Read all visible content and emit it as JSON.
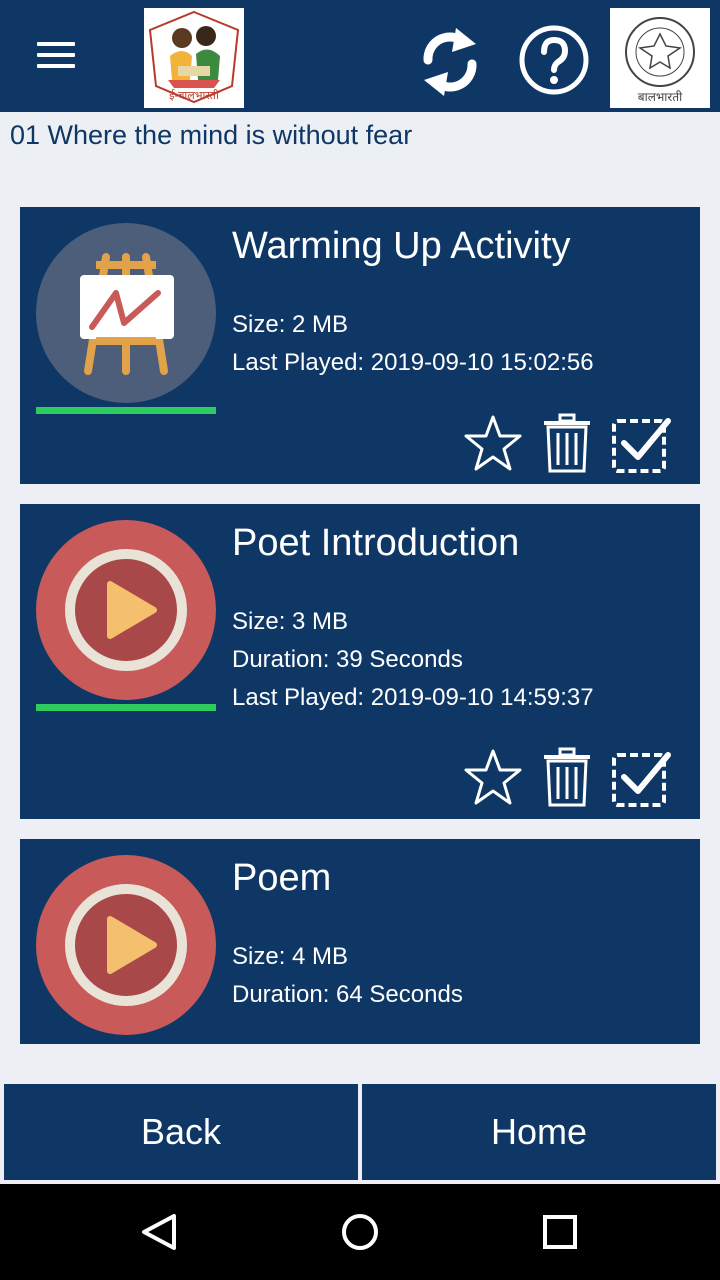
{
  "header": {
    "menu_icon": "hamburger-menu-icon",
    "left_logo": "e-balbharati-logo",
    "left_logo_text": "ई-बालभारती",
    "sync_icon": "sync-icon",
    "help_icon": "help-icon",
    "right_logo": "balbharati-emblem-logo",
    "right_logo_text": "बालभारती",
    "bar_color": "#0f3766"
  },
  "subtitle": "01 Where the mind is without fear",
  "items": [
    {
      "title": "Warming Up Activity",
      "thumbnail": "easel-activity-icon",
      "size": "Size: 2 MB",
      "last_played": "Last Played: 2019-09-10 15:02:56",
      "progress": 1.0,
      "actions": [
        "star-icon",
        "trash-icon",
        "checkbox-icon"
      ]
    },
    {
      "title": "Poet Introduction",
      "thumbnail": "play-video-icon",
      "size": "Size: 3 MB",
      "duration": "Duration: 39 Seconds",
      "last_played": "Last Played: 2019-09-10 14:59:37",
      "progress": 1.0,
      "actions": [
        "star-icon",
        "trash-icon",
        "checkbox-icon"
      ]
    },
    {
      "title": "Poem",
      "thumbnail": "play-video-icon",
      "size": "Size: 4 MB",
      "duration": "Duration: 64 Seconds"
    }
  ],
  "footer": {
    "back_label": "Back",
    "home_label": "Home"
  },
  "system_nav": {
    "back_icon": "nav-back-icon",
    "home_icon": "nav-home-icon",
    "recents_icon": "nav-recents-icon"
  },
  "colors": {
    "accent": "#0f3766",
    "progress": "#2ecc5e",
    "play_red": "#c85a5a",
    "background": "#eceff3"
  }
}
